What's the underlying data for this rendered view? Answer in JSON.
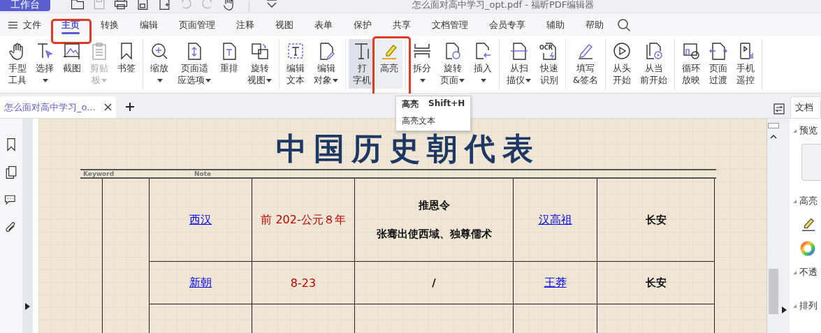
{
  "title_bar": {
    "workbench_button": "工作台",
    "title": "怎么面对高中学习_opt.pdf - 福昕PDF编辑器",
    "quick_tools": [
      {
        "disabled": false
      },
      {
        "disabled": true
      },
      {
        "disabled": false
      },
      {
        "disabled": false
      },
      {
        "disabled": false
      },
      {
        "disabled": true
      },
      {
        "disabled": true
      },
      {
        "disabled": false
      }
    ]
  },
  "menu": {
    "file": "文件",
    "tabs": [
      {
        "label": "主页",
        "selected": true,
        "annotated": true
      },
      {
        "label": "转换",
        "selected": false,
        "annotated": false
      },
      {
        "label": "编辑",
        "selected": false,
        "annotated": false
      },
      {
        "label": "页面管理",
        "selected": false,
        "annotated": false
      },
      {
        "label": "注释",
        "selected": false,
        "annotated": false
      },
      {
        "label": "视图",
        "selected": false,
        "annotated": false
      },
      {
        "label": "表单",
        "selected": false,
        "annotated": false
      },
      {
        "label": "保护",
        "selected": false,
        "annotated": false
      },
      {
        "label": "共享",
        "selected": false,
        "annotated": false
      },
      {
        "label": "文档管理",
        "selected": false,
        "annotated": false
      },
      {
        "label": "会员专享",
        "selected": false,
        "annotated": false
      },
      {
        "label": "辅助",
        "selected": false,
        "annotated": false
      },
      {
        "label": "帮助",
        "selected": false,
        "annotated": false
      }
    ]
  },
  "ribbon": {
    "groups": [
      [
        {
          "lines": [
            "手型",
            "工具"
          ],
          "dropdown": false,
          "disabled": false,
          "selected": false,
          "hovered": false,
          "annotated": false
        },
        {
          "lines": [
            "选择"
          ],
          "dropdown": true,
          "disabled": false,
          "selected": false,
          "hovered": false,
          "annotated": false
        },
        {
          "lines": [
            "截图"
          ],
          "dropdown": false,
          "disabled": false,
          "selected": false,
          "hovered": false,
          "annotated": false
        },
        {
          "lines": [
            "剪贴",
            "板"
          ],
          "dropdown": true,
          "disabled": true,
          "selected": false,
          "hovered": false,
          "annotated": false
        },
        {
          "lines": [
            "书签"
          ],
          "dropdown": false,
          "disabled": false,
          "selected": false,
          "hovered": false,
          "annotated": false
        }
      ],
      [
        {
          "lines": [
            "缩放"
          ],
          "dropdown": true,
          "disabled": false,
          "selected": false,
          "hovered": false,
          "annotated": false
        },
        {
          "lines": [
            "页面适",
            "应选项"
          ],
          "dropdown": true,
          "disabled": false,
          "selected": false,
          "hovered": false,
          "annotated": false
        },
        {
          "lines": [
            "重排"
          ],
          "dropdown": false,
          "disabled": false,
          "selected": false,
          "hovered": false,
          "annotated": false
        },
        {
          "lines": [
            "旋转",
            "视图"
          ],
          "dropdown": true,
          "disabled": false,
          "selected": false,
          "hovered": false,
          "annotated": false
        }
      ],
      [
        {
          "lines": [
            "编辑",
            "文本"
          ],
          "dropdown": false,
          "disabled": false,
          "selected": false,
          "hovered": false,
          "annotated": false
        },
        {
          "lines": [
            "编辑",
            "对象"
          ],
          "dropdown": true,
          "disabled": false,
          "selected": false,
          "hovered": false,
          "annotated": false
        }
      ],
      [
        {
          "lines": [
            "打",
            "字机"
          ],
          "dropdown": false,
          "disabled": false,
          "selected": true,
          "hovered": false,
          "annotated": false
        },
        {
          "lines": [
            "高亮"
          ],
          "dropdown": false,
          "disabled": false,
          "selected": false,
          "hovered": true,
          "annotated": true
        }
      ],
      [
        {
          "lines": [
            "拆分"
          ],
          "dropdown": true,
          "disabled": false,
          "selected": false,
          "hovered": false,
          "annotated": false
        },
        {
          "lines": [
            "旋转",
            "页面"
          ],
          "dropdown": true,
          "disabled": false,
          "selected": false,
          "hovered": false,
          "annotated": false
        },
        {
          "lines": [
            "插入"
          ],
          "dropdown": true,
          "disabled": false,
          "selected": false,
          "hovered": false,
          "annotated": false
        }
      ],
      [
        {
          "lines": [
            "从扫",
            "描仪"
          ],
          "dropdown": true,
          "disabled": false,
          "selected": false,
          "hovered": false,
          "annotated": false
        },
        {
          "lines": [
            "快速",
            "识别"
          ],
          "icon_text": "OCR",
          "dropdown": false,
          "disabled": false,
          "selected": false,
          "hovered": false,
          "annotated": false
        }
      ],
      [
        {
          "lines": [
            "填写",
            "&签名"
          ],
          "dropdown": false,
          "disabled": false,
          "selected": false,
          "hovered": false,
          "annotated": false
        }
      ],
      [
        {
          "lines": [
            "从头",
            "开始"
          ],
          "dropdown": false,
          "disabled": false,
          "selected": false,
          "hovered": false,
          "annotated": false
        },
        {
          "lines": [
            "从当",
            "前开始"
          ],
          "dropdown": false,
          "disabled": false,
          "selected": false,
          "hovered": false,
          "annotated": false
        }
      ],
      [
        {
          "lines": [
            "循环",
            "放映"
          ],
          "dropdown": false,
          "disabled": false,
          "selected": false,
          "hovered": false,
          "annotated": false
        },
        {
          "lines": [
            "页面",
            "过渡"
          ],
          "dropdown": false,
          "disabled": false,
          "selected": false,
          "hovered": false,
          "annotated": false
        },
        {
          "lines": [
            "手机",
            "遥控"
          ],
          "dropdown": false,
          "disabled": false,
          "selected": false,
          "hovered": false,
          "annotated": false
        }
      ]
    ]
  },
  "tooltip": {
    "title": "高亮",
    "shortcut": "Shift+H",
    "description": "高亮文本"
  },
  "document_tabs": [
    {
      "label": "怎么面对高中学习_o...",
      "selected": true
    }
  ],
  "document": {
    "title": "中国历史朝代表",
    "header_labels": [
      "Keyword",
      "Note"
    ],
    "rows": [
      {
        "cells": [
          {
            "kind": "link",
            "lines": [
              "西汉"
            ]
          },
          {
            "kind": "red",
            "lines": [
              "前 202-公元８年"
            ]
          },
          {
            "kind": "bold",
            "lines": [
              "推恩令",
              "张骞出使西域、独尊儒术"
            ]
          },
          {
            "kind": "link",
            "lines": [
              "汉高祖"
            ]
          },
          {
            "kind": "bold",
            "lines": [
              "长安"
            ]
          }
        ]
      },
      {
        "cells": [
          {
            "kind": "link",
            "lines": [
              "新朝"
            ]
          },
          {
            "kind": "red",
            "lines": [
              "8-23"
            ]
          },
          {
            "kind": "bold",
            "lines": [
              "/"
            ]
          },
          {
            "kind": "link",
            "lines": [
              "王莽"
            ]
          },
          {
            "kind": "bold",
            "lines": [
              "长安"
            ]
          }
        ]
      }
    ]
  },
  "right_panel": {
    "tab": "文档",
    "sections": [
      {
        "label": "预览",
        "kind": "preview"
      },
      {
        "label": "高亮",
        "kind": "tools"
      },
      {
        "label": "不透",
        "kind": "plain"
      },
      {
        "label": "排列",
        "kind": "plain"
      }
    ]
  }
}
